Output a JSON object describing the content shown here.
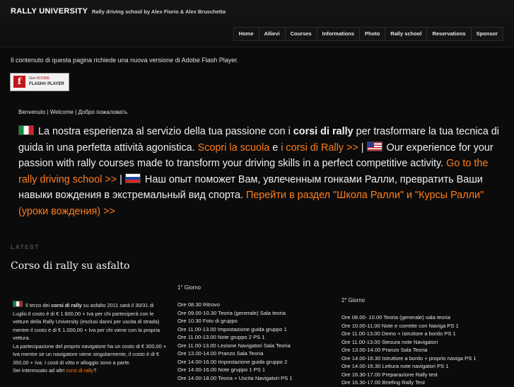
{
  "header": {
    "brand": "RALLY UNIVERSITY",
    "tagline": "Rally driving school by Alex Fiorio & Alex Bruschetta"
  },
  "nav": [
    "Home",
    "Allievi",
    "Courses",
    "Informations",
    "Photo",
    "Rally school",
    "Reservations",
    "Sponsor"
  ],
  "flash": {
    "message": "Il contenuto di questa pagina richiede una nuova versione di Adobe Flash Player.",
    "logo_letter": "f",
    "badge_get": "Get",
    "badge_adobe": "ADOBE",
    "badge_product": "FLASH® PLAYER"
  },
  "welcome": "Benvenuto | Welcome | Добро пожаловать",
  "intro": {
    "it_text_1": "La nostra esperienza al servizio della tua passione con i ",
    "it_bold": "corsi di rally",
    "it_text_2": " per trasformare la tua tecnica di guida in una perfetta attività agonistica. ",
    "it_link_1": "Scopri la scuola",
    "it_and": " e ",
    "it_link_2": "i corsi di Rally >>",
    "sep": " | ",
    "en_text": " Our experience for your passion with rally courses made to transform your driving skills in a perfect competitive activity. ",
    "en_link": "Go to the rally driving school >>",
    "ru_text": " Наш опыт поможет Вам, увлеченным гонками Ралли, превратить Ваши навыки вождения в экстремальный вид спорта. ",
    "ru_link": "Перейти в раздел \"Школа Ралли\" и \"Курсы Ралли\" (уроки вождения) >>"
  },
  "latest_label": "LATEST",
  "post": {
    "title": "Corso di rally su asfalto",
    "p1_a": " Il terzo dei ",
    "p1_bold": "corsi di rally",
    "p1_b": " su asfalto 2011 sarà il 30/31 di Luglio.Il costo è di € 1.900,00 + Iva per chi parteciperà con le vetture della Rally University (esclusi danni per uscita di strada) mentre il costo è di € 1.000,00 + Iva per chi viene con la propria vettura.",
    "p2": "La partecipazione del proprio navigatore ha un costo di € 300,00 + Iva mentre se un navigatore viene singolarmente, il costo è di € 350,00 + Iva. I costi di vitto e alloggio sono a parte.",
    "p3_a": "Sei interessato ad altri ",
    "p3_link": "corsi di rally",
    "p3_b": "?"
  },
  "day1": {
    "title": "1° Giorno",
    "items": [
      "Ore 08.30 Ritrovo",
      "Ore 09.00-10.30 Teoria (generale) Sala teoria",
      "Ore 10.30 Foto di gruppo",
      "Ore 11.00-13.00 Impostazione guida gruppo 1",
      "Ore 11.00-13.00 Note gruppo 2 PS 1",
      "Ore 11.00-13.00 Lezione Navigatori Sala Teoria",
      "Ore 13.00-14.00 Pranzo Sala Teoria",
      "Ore 14.00-16.00 Impostazione guida gruppo 2",
      "Ore 14.00-16.00 Note gruppo 1 PS 1",
      "Ore 14.00-18.00 Teoria + Uscita Navigatori PS 1"
    ]
  },
  "day2": {
    "title": "2° Giorno",
    "items": [
      "Ore 08.00- 10.00 Teoria (generale) sala teoria",
      "Ore 10.00-11.00 Note e corrette con Naviga PS 1",
      "Ore 11.00-13.00 Demo + istruttore a bordo PS 1",
      "Ore 11.00-13.00 Stesura note Navigatori",
      "Ore 13.00-14.00 Pranzo Sala Teoria",
      "Ore 14.00-16.30 Istruttore a bordo + proprio naviga PS 1",
      "Ore 14.00-16.30 Lettura note navigatori PS 1",
      "Ore 16.30-17.00 Preparazione Rally test",
      "Ore 16.30-17.00 Briefing Rally Test"
    ]
  }
}
